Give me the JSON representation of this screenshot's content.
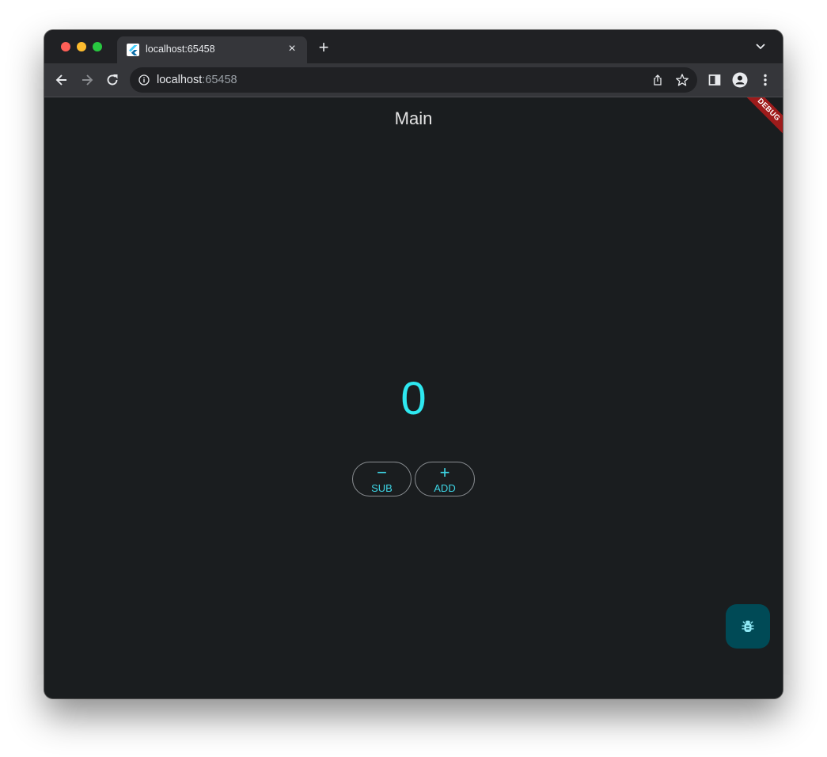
{
  "browser": {
    "tab": {
      "title": "localhost:65458",
      "close_glyph": "×"
    },
    "new_tab_glyph": "+",
    "address": {
      "host": "localhost",
      "port": ":65458"
    }
  },
  "app": {
    "title": "Main",
    "debug_banner": "DEBUG",
    "counter": "0",
    "buttons": {
      "sub": {
        "glyph": "−",
        "label": "SUB"
      },
      "add": {
        "glyph": "+",
        "label": "ADD"
      }
    },
    "fab_icon": "bug-icon"
  },
  "colors": {
    "accent": "#2ee8f0",
    "background": "#1a1d1f",
    "fab": "#004a56",
    "debug_banner": "#9e1b1b"
  }
}
